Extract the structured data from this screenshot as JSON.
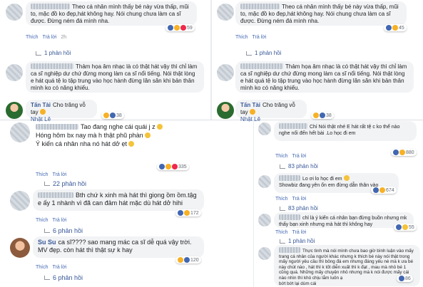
{
  "colors": {
    "link": "#385898",
    "bubble": "#f2f3f5",
    "meta": "#90949c"
  },
  "actions": {
    "like": "Thích",
    "reply": "Trả lời"
  },
  "panel1": {
    "c1": {
      "text": "Theo cá nhân mình thấy bé này vừa thấp, mũi to, mặc đồ ko đẹp,hát không hay. Nói chung chưa làm ca sĩ được. Đừng ném đá mình nha.",
      "count": "59",
      "time": "2h",
      "replies": "1 phản hồi"
    },
    "c2": {
      "text": "Thảm họa âm nhạc là có thật hát vậy thì chỉ làm ca sĩ nghiệp dư chứ đừng mong làm ca sĩ nổi tiếng. Nói thật lòng e hát quá tệ lo tập trung vào học hành đừng lăn săn khi bản thân mình ko có năng khiếu."
    },
    "c3": {
      "name": "Tấn Tài",
      "text": "Cho trăng vỗ tay",
      "tag": "Nhật Lê",
      "count": "38"
    }
  },
  "panel2": {
    "c1": {
      "text": "Theo cá nhân mình thấy bé này vừa thấp, mũi to, mặc đồ ko đẹp,hát không hay. Nói chung chưa làm ca sĩ được. Đừng ném đá mình nha.",
      "count": "45",
      "replies": "1 phản hồi"
    },
    "c2": {
      "text": "Thảm họa âm nhạc là có thật hát vậy thì chỉ làm ca sĩ nghiệp dư chứ đừng mong làm ca sĩ nổi tiếng. Nói thật lòng e hát quá tệ lo tập trung vào học hành đừng lăn săn khi bản thân mình ko có năng khiếu."
    },
    "c3": {
      "name": "Tấn Tài",
      "text": "Cho trăng vỗ tay",
      "tag": "Nhật Lê",
      "count": "38"
    }
  },
  "panel3": {
    "c1": {
      "text": "Tao đang nghe cái quái j z",
      "line2": "Hóng hôm bx nay mà h thật phũ phàn",
      "line3": "Ý kiến cá nhân nha nó hát dở ẹt",
      "count": "335",
      "replies": "22 phản hồi"
    },
    "c2": {
      "text": "Bth chứ k xinh mà hát thì giọng ồm ồm.tậg e ấy 1 nhành vì đã can đảm hát mặc dù hát dở hihi",
      "count": "172",
      "replies": "6 phản hồi"
    },
    "c3": {
      "name": "Su Su",
      "text": "ca sĩ???? sao mang mác ca sĩ dễ quá vậy trời. MV đẹp. còn hát thì thật sự k hay",
      "count": "120",
      "replies": "6 phản hồi"
    }
  },
  "panel4": {
    "c1": {
      "text": "Chỉ Nói thật nhé E hát rất tệ c ko thể nào nghe nổi đến hết bài .Lo học đi em",
      "count": "880",
      "replies": "83 phản hồi"
    },
    "c2": {
      "text": "Lo ơi lo học đi em",
      "line2": "Showbiz đang yên ổn em đừng dẫn thân vào",
      "count": "674",
      "replies": "83 phản hồi"
    },
    "c3": {
      "text": "chỉ là ý kiến cá nhân bạn đừng buồn nhưng mk thấy bạn xinh nhưng mà hát thì không hay",
      "count": "55",
      "replies": "1 phản hồi"
    },
    "c4": {
      "text": "Thực tình mà nói mình chưa bao giờ bình luận vào mấy trang cá nhân của người khác nhưng k thích bé này nói thật trong mấy người yêu cầu thì bông đá em nhưng đáng yêu nè mà k ưa bé này chút nào , hát thì k tốt diễn xuất thì k đạt , mau mà nhỏ bé 1 cũng quá. Những mấy chuyện nhỏ nhưng mà k nói được mấy cái nào nhìn thì khó chịu lắm luôn ạ",
      "line2": "bớt bớt lại dùm cái",
      "count": "86"
    }
  }
}
